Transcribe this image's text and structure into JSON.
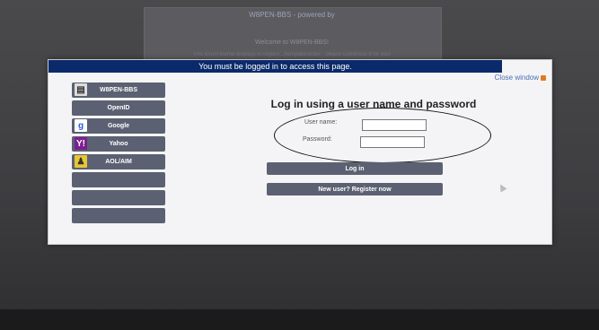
{
  "background": {
    "title": "W8PEN-BBS - powered by",
    "welcome": "Welcome to W8PEN-BBS!",
    "notice": "This forum theme displays in /styles/.../template/index - please customize it for your"
  },
  "dialog": {
    "header": "You must be logged in to access this page.",
    "close_label": "Close window",
    "providers": [
      {
        "label": "W8PEN-BBS",
        "icon": "bbs-icon",
        "glyph": "▤"
      },
      {
        "label": "OpenID",
        "icon": "",
        "glyph": ""
      },
      {
        "label": "Google",
        "icon": "google-icon",
        "glyph": "g"
      },
      {
        "label": "Yahoo",
        "icon": "yahoo-icon",
        "glyph": "Y!"
      },
      {
        "label": "AOL/AIM",
        "icon": "aol-icon",
        "glyph": "♟"
      },
      {
        "label": "",
        "icon": "",
        "glyph": ""
      },
      {
        "label": "",
        "icon": "",
        "glyph": ""
      },
      {
        "label": "",
        "icon": "",
        "glyph": ""
      }
    ],
    "login_title": "Log in using a user name and password",
    "username_label": "User name:",
    "password_label": "Password:",
    "username_value": "",
    "password_value": "",
    "login_button": "Log in",
    "register_button": "New user? Register now"
  }
}
